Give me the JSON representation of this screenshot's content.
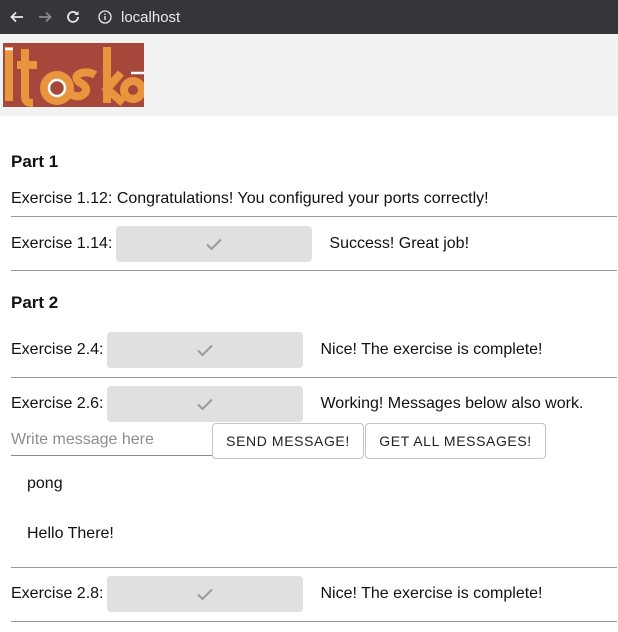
{
  "browser": {
    "url": "localhost"
  },
  "part1": {
    "heading": "Part 1",
    "ex112": "Exercise 1.12: Congratulations! You configured your ports correctly!",
    "ex114": {
      "label": "Exercise 1.14:",
      "message": "Success! Great job!"
    }
  },
  "part2": {
    "heading": "Part 2",
    "ex24": {
      "label": "Exercise 2.4:",
      "message": "Nice! The exercise is complete!"
    },
    "ex26": {
      "label": "Exercise 2.6:",
      "message": "Working! Messages below also work."
    },
    "message_input": {
      "placeholder": "Write message here",
      "value": ""
    },
    "send_button": "SEND MESSAGE!",
    "get_all_button": "GET ALL MESSAGES!",
    "messages": [
      "pong",
      "Hello There!"
    ],
    "ex28": {
      "label": "Exercise 2.8:",
      "message": "Nice! The exercise is complete!"
    }
  },
  "colors": {
    "logo_dark": "#a5473b",
    "logo_light": "#e8953e",
    "browser_bar": "#35363a",
    "check_button": "#e0e0e0"
  }
}
